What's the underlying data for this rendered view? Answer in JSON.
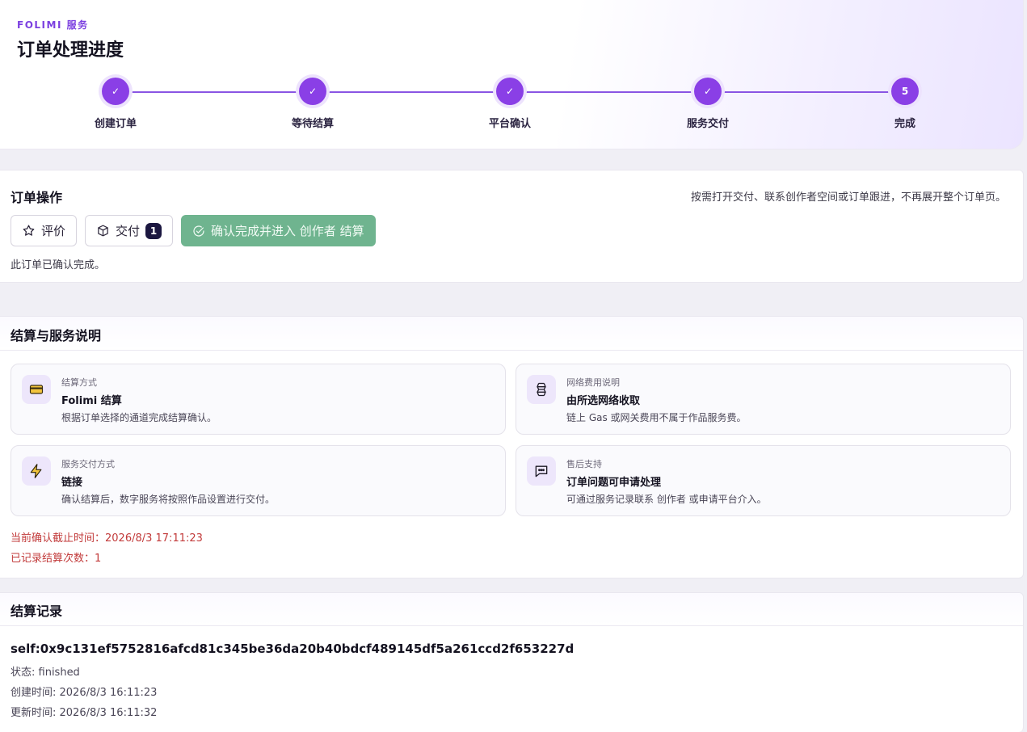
{
  "header": {
    "brand": "FOLIMI 服务",
    "title": "订单处理进度"
  },
  "steps": [
    {
      "label": "创建订单",
      "status": "done",
      "marker": "✓"
    },
    {
      "label": "等待结算",
      "status": "done",
      "marker": "✓"
    },
    {
      "label": "平台确认",
      "status": "done",
      "marker": "✓"
    },
    {
      "label": "服务交付",
      "status": "done",
      "marker": "✓"
    },
    {
      "label": "完成",
      "status": "current",
      "marker": "5"
    }
  ],
  "actions": {
    "title": "订单操作",
    "hint": "按需打开交付、联系创作者空间或订单跟进，不再展开整个订单页。",
    "review_label": "评价",
    "delivery_label": "交付",
    "delivery_count": "1",
    "confirm_label": "确认完成并进入 创作者 结算",
    "note": "此订单已确认完成。"
  },
  "settlement": {
    "title": "结算与服务说明",
    "cards": [
      {
        "icon": "card-icon",
        "sub": "结算方式",
        "main": "Folimi 结算",
        "desc": "根据订单选择的通道完成结算确认。"
      },
      {
        "icon": "network-icon",
        "sub": "网络费用说明",
        "main": "由所选网络收取",
        "desc": "链上 Gas 或网关费用不属于作品服务费。"
      },
      {
        "icon": "lightning-icon",
        "sub": "服务交付方式",
        "main": "链接",
        "desc": "确认结算后，数字服务将按照作品设置进行交付。"
      },
      {
        "icon": "chat-icon",
        "sub": "售后支持",
        "main": "订单问题可申请处理",
        "desc": "可通过服务记录联系 创作者 或申请平台介入。"
      }
    ],
    "deadline": "当前确认截止时间：2026/8/3 17:11:23",
    "settle_count": "已记录结算次数：1"
  },
  "records": {
    "title": "结算记录",
    "id": "self:0x9c131ef5752816afcd81c345be36da20b40bdcf489145df5a261ccd2f653227d",
    "status": "状态: finished",
    "created": "创建时间: 2026/8/3 16:11:23",
    "updated": "更新时间: 2026/8/3 16:11:32"
  },
  "colors": {
    "accent": "#8a3fe6",
    "confirm": "#6fb48f",
    "warning": "#c23a3a"
  }
}
